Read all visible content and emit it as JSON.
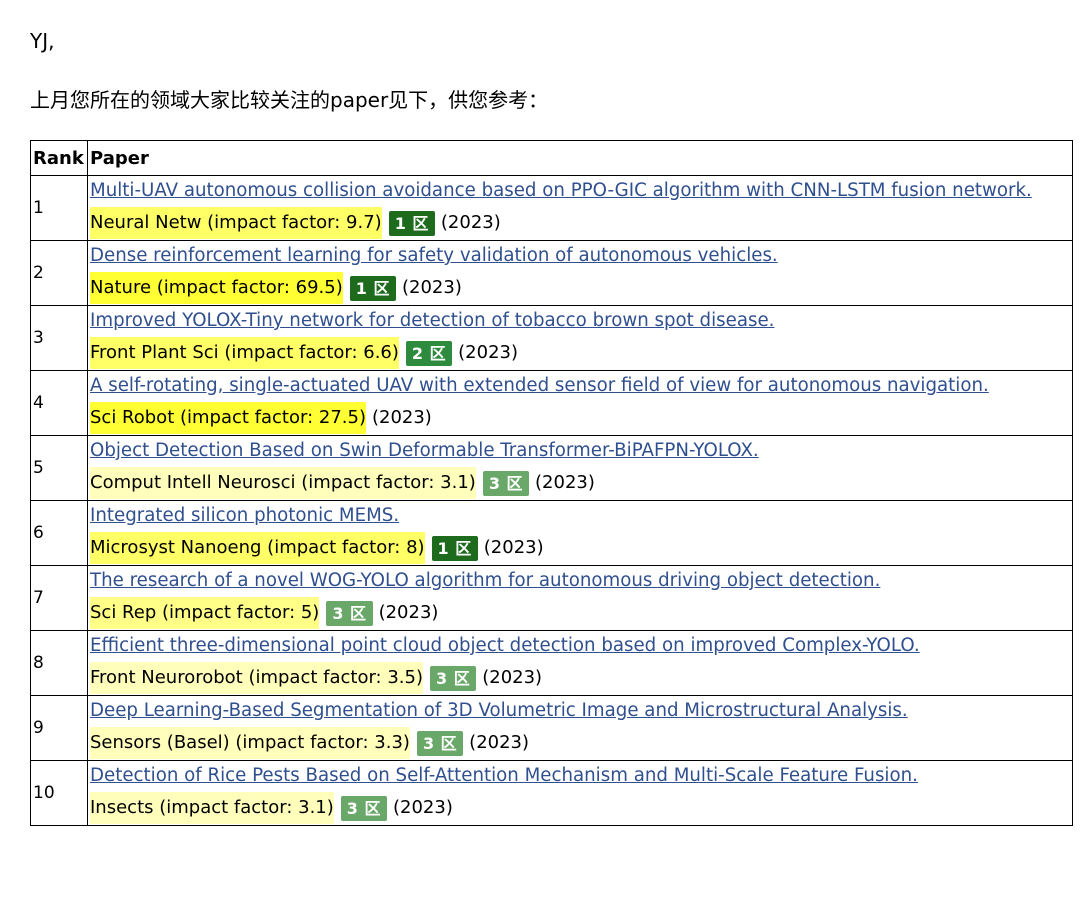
{
  "greeting": "YJ,",
  "intro": "上月您所在的领域大家比较关注的paper见下，供您参考：",
  "table": {
    "headers": {
      "rank": "Rank",
      "paper": "Paper"
    },
    "rows": [
      {
        "rank": "1",
        "title": "Multi-UAV autonomous collision avoidance based on PPO-GIC algorithm with CNN-LSTM fusion network.",
        "journal": "Neural Netw (impact factor: 9.7)",
        "journal_bg": "#ffff66",
        "zone": "1 区",
        "zone_color": "#1e6b1e",
        "year": "(2023)"
      },
      {
        "rank": "2",
        "title": "Dense reinforcement learning for safety validation of autonomous vehicles.",
        "journal": "Nature (impact factor: 69.5)",
        "journal_bg": "#ffff33",
        "zone": "1 区",
        "zone_color": "#1e6b1e",
        "year": "(2023)"
      },
      {
        "rank": "3",
        "title": "Improved YOLOX-Tiny network for detection of tobacco brown spot disease.",
        "journal": "Front Plant Sci (impact factor: 6.6)",
        "journal_bg": "#ffff66",
        "zone": "2 区",
        "zone_color": "#2e8b3e",
        "year": "(2023)"
      },
      {
        "rank": "4",
        "title": "A self-rotating, single-actuated UAV with extended sensor field of view for autonomous navigation.",
        "journal": "Sci Robot (impact factor: 27.5)",
        "journal_bg": "#ffff33",
        "zone": "",
        "zone_color": "#1e6b1e",
        "year": "(2023)"
      },
      {
        "rank": "5",
        "title": "Object Detection Based on Swin Deformable Transformer-BiPAFPN-YOLOX.",
        "journal": "Comput Intell Neurosci (impact factor: 3.1)",
        "journal_bg": "#ffffbb",
        "zone": "3 区",
        "zone_color": "#6aa86a",
        "year": "(2023)"
      },
      {
        "rank": "6",
        "title": "Integrated silicon photonic MEMS.",
        "journal": "Microsyst Nanoeng (impact factor: 8)",
        "journal_bg": "#ffff66",
        "zone": "1 区",
        "zone_color": "#1e6b1e",
        "year": "(2023)"
      },
      {
        "rank": "7",
        "title": "The research of a novel WOG-YOLO algorithm for autonomous driving object detection.",
        "journal": "Sci Rep (impact factor: 5)",
        "journal_bg": "#ffff88",
        "zone": "3 区",
        "zone_color": "#6aa86a",
        "year": "(2023)"
      },
      {
        "rank": "8",
        "title": "Efficient three-dimensional point cloud object detection based on improved Complex-YOLO.",
        "journal": "Front Neurorobot (impact factor: 3.5)",
        "journal_bg": "#ffffbb",
        "zone": "3 区",
        "zone_color": "#6aa86a",
        "year": "(2023)"
      },
      {
        "rank": "9",
        "title": "Deep Learning-Based Segmentation of 3D Volumetric Image and Microstructural Analysis.",
        "journal": "Sensors (Basel) (impact factor: 3.3)",
        "journal_bg": "#ffffbb",
        "zone": "3 区",
        "zone_color": "#6aa86a",
        "year": "(2023)"
      },
      {
        "rank": "10",
        "title": "Detection of Rice Pests Based on Self-Attention Mechanism and Multi-Scale Feature Fusion.",
        "journal": "Insects (impact factor: 3.1)",
        "journal_bg": "#ffffbb",
        "zone": "3 区",
        "zone_color": "#6aa86a",
        "year": "(2023)"
      }
    ]
  }
}
